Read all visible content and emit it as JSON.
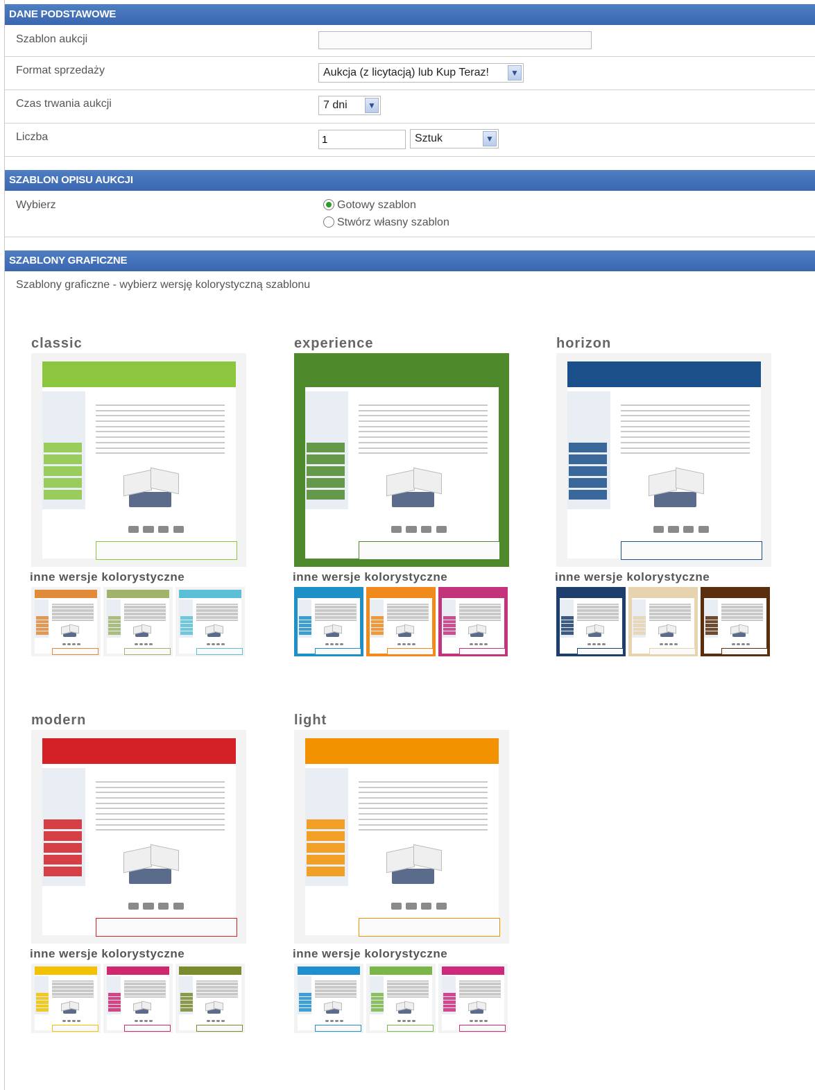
{
  "sections": {
    "basic": {
      "title": "DANE PODSTAWOWE",
      "rows": {
        "template_label": "Szablon aukcji",
        "template_value": "",
        "format_label": "Format sprzedaży",
        "format_value": "Aukcja (z licytacją) lub Kup Teraz!",
        "duration_label": "Czas trwania aukcji",
        "duration_value": "7 dni",
        "quantity_label": "Liczba",
        "quantity_value": "1",
        "unit_value": "Sztuk"
      }
    },
    "description": {
      "title": "SZABLON OPISU AUKCJI",
      "choose_label": "Wybierz",
      "option_ready": "Gotowy szablon",
      "option_own": "Stwórz własny szablon",
      "selected": "Gotowy szablon"
    },
    "graphic": {
      "title": "SZABLONY GRAFICZNE",
      "intro": "Szablony graficzne - wybierz wersję kolorystyczną szablonu",
      "variants_label": "inne wersje kolorystyczne",
      "templates": [
        {
          "name": "classic",
          "accent": "#8cc63f",
          "variants": [
            "#e08a3a",
            "#9fb36a",
            "#5bc0d6"
          ]
        },
        {
          "name": "experience",
          "accent": "#4e8a2c",
          "variants": [
            "#1f8fc8",
            "#f08a1c",
            "#c4347c"
          ]
        },
        {
          "name": "horizon",
          "accent": "#1a4f8a",
          "variants": [
            "#1e3f6e",
            "#e8d3b0",
            "#5a2d0c"
          ]
        },
        {
          "name": "modern",
          "accent": "#d42027",
          "variants": [
            "#f2c200",
            "#d0286e",
            "#7a8b2c"
          ]
        },
        {
          "name": "light",
          "accent": "#f39200",
          "variants": [
            "#1e90d0",
            "#7ab648",
            "#d0287c"
          ]
        }
      ]
    }
  }
}
